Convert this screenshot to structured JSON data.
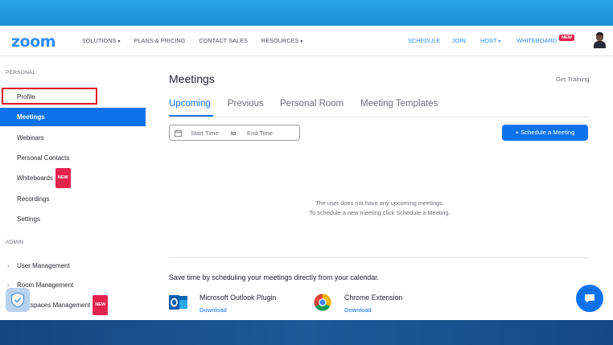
{
  "header": {
    "logo": "zoom",
    "nav_left": [
      {
        "label": "SOLUTIONS",
        "caret": "▾"
      },
      {
        "label": "PLANS & PRICING"
      },
      {
        "label": "CONTACT SALES"
      },
      {
        "label": "RESOURCES",
        "caret": "▾"
      }
    ],
    "nav_right": {
      "schedule": "SCHEDULE",
      "join": "JOIN",
      "host": "HOST",
      "host_caret": "▾",
      "whiteboard": "WHITEBOARD",
      "whiteboard_badge": "NEW"
    }
  },
  "sidebar": {
    "personal_label": "PERSONAL",
    "items": [
      {
        "label": "Profile"
      },
      {
        "label": "Meetings"
      },
      {
        "label": "Webinars"
      },
      {
        "label": "Personal Contacts"
      },
      {
        "label": "Whiteboards",
        "badge": "NEW"
      },
      {
        "label": "Recordings"
      },
      {
        "label": "Settings"
      }
    ],
    "admin_label": "ADMIN",
    "admin_items": [
      {
        "label": "User Management",
        "arrow": "›"
      },
      {
        "label": "Room Management",
        "arrow": "›"
      },
      {
        "label": "kspaces Management",
        "badge": "NEW"
      }
    ]
  },
  "main": {
    "title": "Meetings",
    "get_training": "Get Training",
    "tabs": [
      {
        "label": "Upcoming"
      },
      {
        "label": "Previous"
      },
      {
        "label": "Personal Room"
      },
      {
        "label": "Meeting Templates"
      }
    ],
    "date_range": {
      "start": "Start Time",
      "to": "to",
      "end": "End Time"
    },
    "schedule_button": "+  Schedule a Meeting",
    "empty_line1": "The user does not have any upcoming meetings.",
    "empty_line2": "To schedule a new meeting click Schedule a Meeting.",
    "calendar_text": "Save time by scheduling your meetings directly from your calendar.",
    "plugins": [
      {
        "name": "Microsoft Outlook Plugin",
        "link": "Download"
      },
      {
        "name": "Chrome Extension",
        "link": "Download"
      }
    ]
  },
  "colors": {
    "brand_blue": "#0e72ed",
    "logo_blue": "#2d8cff",
    "badge_red": "#e4234f",
    "highlight_red": "#e0121f"
  }
}
